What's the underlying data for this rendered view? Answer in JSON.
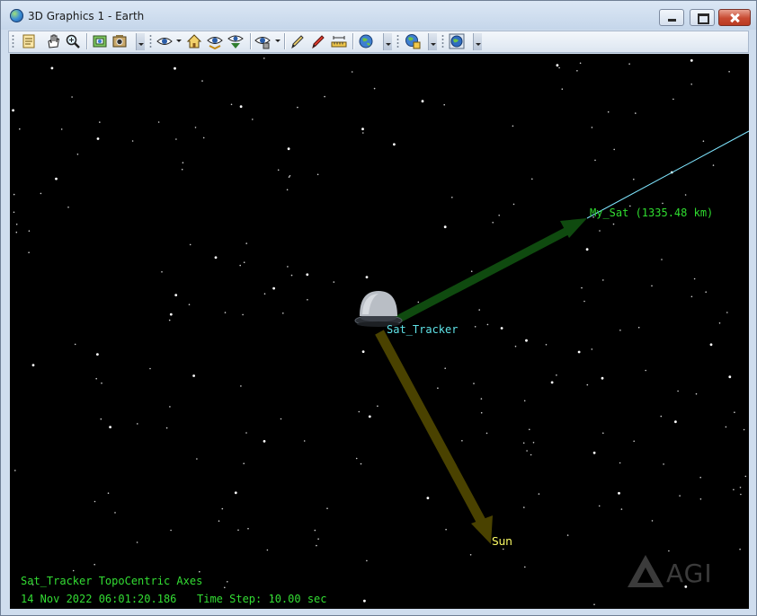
{
  "window": {
    "title": "3D Graphics 1 - Earth"
  },
  "toolbar": {
    "icons": [
      "properties-icon",
      "pan-hand-icon",
      "zoom-icon",
      "map-view-icon",
      "snapshot-icon",
      "view-from-icon",
      "home-view-icon",
      "orbit-view-icon",
      "above-view-icon",
      "object-view-icon",
      "annotate-pen-icon",
      "eraser-pen-icon",
      "measure-ruler-icon",
      "globe-navigate-icon",
      "globe-layers-icon",
      "globe-tools-icon"
    ]
  },
  "scene": {
    "labels": {
      "sat_tracker": "Sat_Tracker",
      "my_sat": "My_Sat (1335.48 km)",
      "sun": "Sun"
    },
    "colors": {
      "background": "#000000",
      "sat_tracker_label": "#5fe3e8",
      "my_sat_label": "#2fdc2f",
      "sun_label": "#ffff66",
      "sat_vector": "#0f4a0f",
      "sun_vector": "#4a4200",
      "orbit_line": "#7fe6ff",
      "hud_text": "#33dd33"
    }
  },
  "hud": {
    "axes_label": "Sat_Tracker TopoCentric Axes",
    "datetime": "14 Nov 2022 06:01:20.186",
    "time_step": "Time Step: 10.00 sec"
  },
  "watermark": {
    "text": "AGI"
  }
}
